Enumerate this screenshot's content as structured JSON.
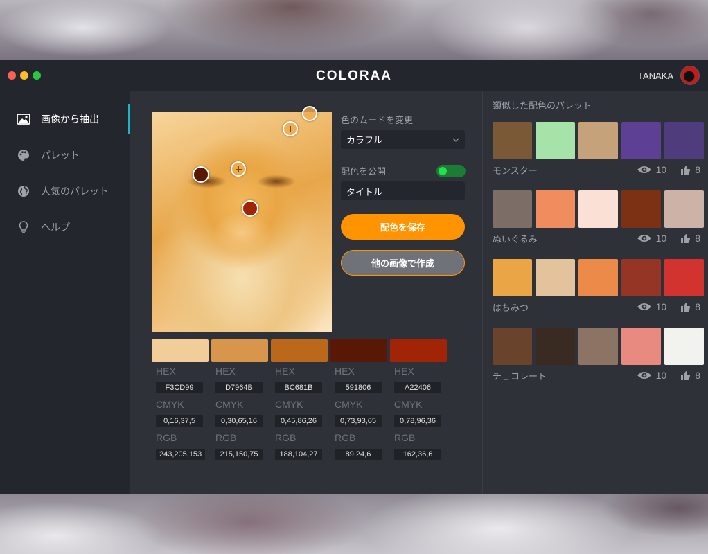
{
  "app": {
    "title": "COLORAA",
    "user": "TANAKA"
  },
  "sidebar": {
    "items": [
      {
        "label": "画像から抽出",
        "icon": "image-icon",
        "active": true
      },
      {
        "label": "パレット",
        "icon": "palette-icon",
        "active": false
      },
      {
        "label": "人気のパレット",
        "icon": "globe-icon",
        "active": false
      },
      {
        "label": "ヘルプ",
        "icon": "lightbulb-icon",
        "active": false
      }
    ]
  },
  "controls": {
    "mood_label": "色のムードを変更",
    "mood_value": "カラフル",
    "publish_label": "配色を公開",
    "publish_on": true,
    "title_value": "タイトル",
    "save_button": "配色を保存",
    "other_image_button": "他の画像で作成"
  },
  "swatches": [
    {
      "color": "#F3CD99",
      "hex_label": "HEX",
      "hex": "F3CD99",
      "cmyk_label": "CMYK",
      "cmyk": "0,16,37,5",
      "rgb_label": "RGB",
      "rgb": "243,205,153"
    },
    {
      "color": "#D7964B",
      "hex_label": "HEX",
      "hex": "D7964B",
      "cmyk_label": "CMYK",
      "cmyk": "0,30,65,16",
      "rgb_label": "RGB",
      "rgb": "215,150,75"
    },
    {
      "color": "#BC681B",
      "hex_label": "HEX",
      "hex": "BC681B",
      "cmyk_label": "CMYK",
      "cmyk": "0,45,86,26",
      "rgb_label": "RGB",
      "rgb": "188,104,27"
    },
    {
      "color": "#591806",
      "hex_label": "HEX",
      "hex": "591806",
      "cmyk_label": "CMYK",
      "cmyk": "0,73,93,65",
      "rgb_label": "RGB",
      "rgb": "89,24,6"
    },
    {
      "color": "#A22406",
      "hex_label": "HEX",
      "hex": "A22406",
      "cmyk_label": "CMYK",
      "cmyk": "0,78,96,36",
      "rgb_label": "RGB",
      "rgb": "162,36,6"
    }
  ],
  "similar": {
    "title": "類似した配色のパレット",
    "palettes": [
      {
        "name": "モンスター",
        "views": "10",
        "likes": "8",
        "colors": [
          "#7a5a36",
          "#a6e3a9",
          "#c5a27a",
          "#5d3f94",
          "#4f3c7d"
        ]
      },
      {
        "name": "ぬいぐるみ",
        "views": "10",
        "likes": "8",
        "colors": [
          "#7c6e66",
          "#f08c5e",
          "#fbe1d5",
          "#7c3014",
          "#cdb2a8"
        ]
      },
      {
        "name": "はちみつ",
        "views": "10",
        "likes": "8",
        "colors": [
          "#eaa546",
          "#e3c39b",
          "#ec8a49",
          "#943526",
          "#d3332e"
        ]
      },
      {
        "name": "チョコレート",
        "views": "10",
        "likes": "8",
        "colors": [
          "#6a432c",
          "#3a2b22",
          "#8c7464",
          "#e88a80",
          "#f2f2ee"
        ]
      }
    ]
  },
  "colors": {
    "accent": "#ff9300",
    "active_bar": "#1ab6c9",
    "toggle": "#22e14a"
  }
}
